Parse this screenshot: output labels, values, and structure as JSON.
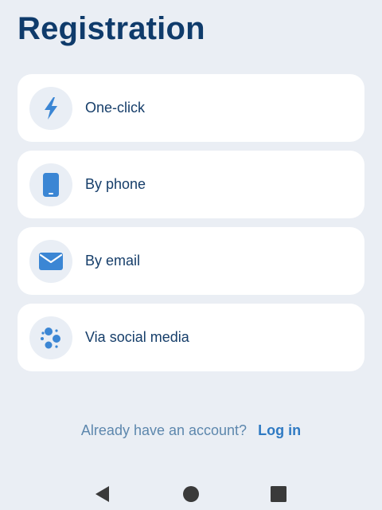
{
  "header": {
    "title": "Registration"
  },
  "options": [
    {
      "label": "One-click",
      "icon": "lightning-icon"
    },
    {
      "label": "By phone",
      "icon": "phone-icon"
    },
    {
      "label": "By email",
      "icon": "envelope-icon"
    },
    {
      "label": "Via social media",
      "icon": "social-dots-icon"
    }
  ],
  "footer": {
    "prompt": "Already have an account?",
    "login_label": "Log in"
  },
  "navbar": {
    "back_icon": "back-triangle-icon",
    "home_icon": "home-circle-icon",
    "recents_icon": "recents-square-icon"
  },
  "colors": {
    "background": "#eaeef4",
    "title": "#0f3b6b",
    "accent": "#3b86d4",
    "link": "#2f7ac3",
    "card": "#ffffff"
  }
}
